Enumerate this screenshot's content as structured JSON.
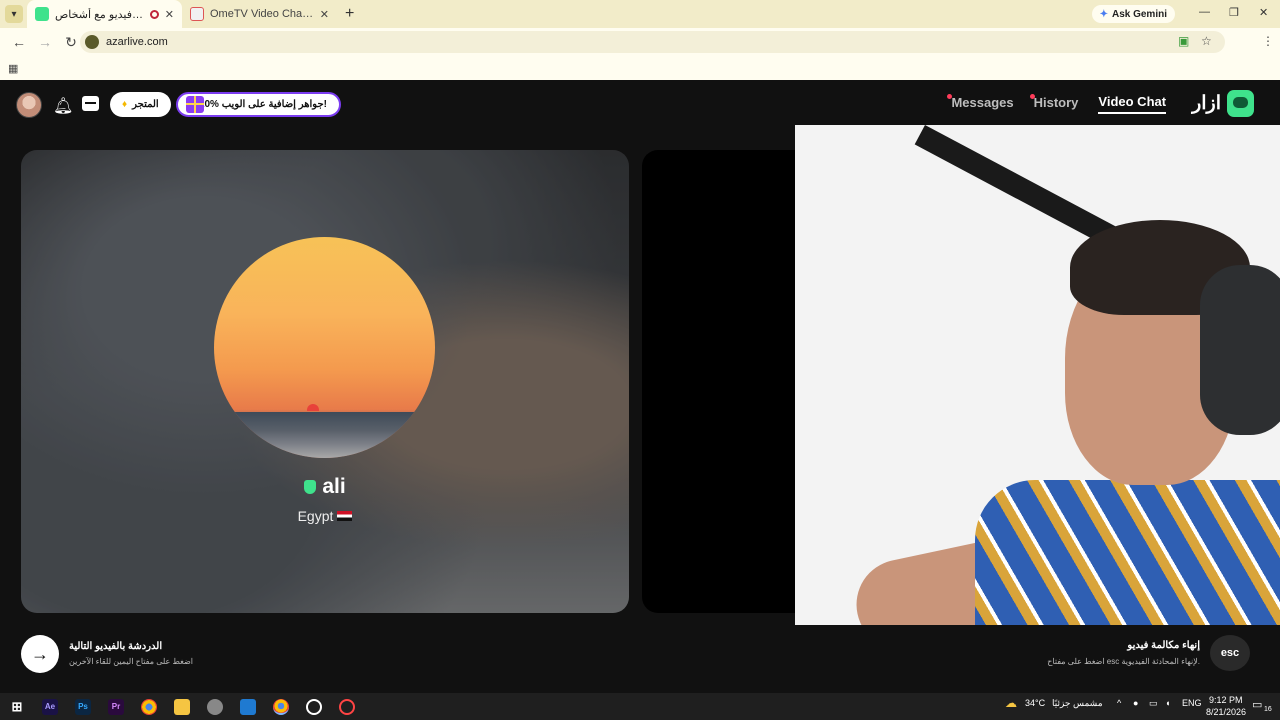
{
  "browser": {
    "tabs": [
      {
        "title": "أزار: دردشة فيديو مع أشخاص",
        "active": true
      },
      {
        "title": "OmeTV Video Chat — Omegle",
        "active": false
      }
    ],
    "new_tab": "+",
    "ask_gemini": "Ask Gemini",
    "url": "azarlive.com",
    "window_controls": {
      "minimize": "—",
      "restore": "❐",
      "close": "✕"
    }
  },
  "header": {
    "shop_label": "المتجر",
    "promo_label": "10% جواهر إضافية على الويب!",
    "nav": {
      "messages": "Messages",
      "history": "History",
      "video_chat": "Video Chat"
    },
    "brand": "ازار"
  },
  "partner": {
    "name": "ali",
    "country": "Egypt"
  },
  "footer": {
    "next_title": "الدردشة بالفيديو التالية",
    "next_sub": "اضغط على مفتاح اليمين للقاء الآخرين",
    "esc_label": "esc",
    "end_title": "إنهاء مكالمة فيديو",
    "end_sub": "اضغط على مفتاح esc لإنهاء المحادثة الفيديوية."
  },
  "taskbar": {
    "weather_temp": "34°C",
    "weather_desc": "مشمس جزئيًا",
    "lang": "ENG",
    "time": "9:12 PM",
    "date": "8/21/2026",
    "notif_count": "16"
  },
  "colors": {
    "accent_green": "#3fe28c",
    "promo_purple": "#7b3cf0",
    "notif_red": "#ff3c5a",
    "tab_bar": "#f2ecc9"
  }
}
